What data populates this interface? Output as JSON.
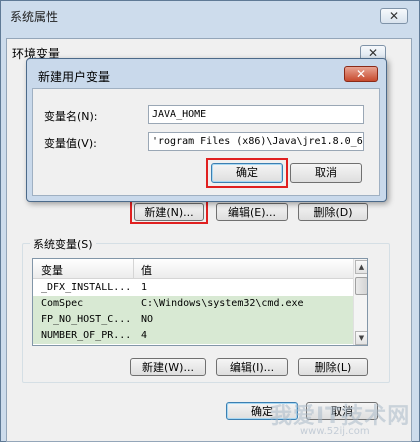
{
  "outer_window": {
    "title": "系统属性",
    "close": "✕"
  },
  "env_window": {
    "title": "环境变量",
    "close": "✕"
  },
  "new_var_dialog": {
    "title": "新建用户变量",
    "close": "✕",
    "name_label": "变量名(N):",
    "name_value": "JAVA_HOME",
    "value_label": "变量值(V):",
    "value_value": "'rogram Files (x86)\\Java\\jre1.8.0_66",
    "ok": "确定",
    "cancel": "取消"
  },
  "user_vars_buttons": {
    "new": "新建(N)...",
    "edit": "编辑(E)...",
    "delete": "删除(D)"
  },
  "system_vars": {
    "title": "系统变量(S)",
    "columns": [
      "变量",
      "值"
    ],
    "rows": [
      {
        "name": "_DFX_INSTALL...",
        "value": "1"
      },
      {
        "name": "ComSpec",
        "value": "C:\\Windows\\system32\\cmd.exe"
      },
      {
        "name": "FP_NO_HOST_C...",
        "value": "NO"
      },
      {
        "name": "NUMBER_OF_PR...",
        "value": "4"
      }
    ],
    "buttons": {
      "new": "新建(W)...",
      "edit": "编辑(I)...",
      "delete": "删除(L)"
    }
  },
  "footer": {
    "ok": "确定",
    "cancel": "取消"
  },
  "watermark": {
    "main": "我爱IT技术网",
    "sub": "www.52ij.com"
  },
  "colors": {
    "highlight": "#e02020",
    "row_alt": "#d8e9d3"
  }
}
